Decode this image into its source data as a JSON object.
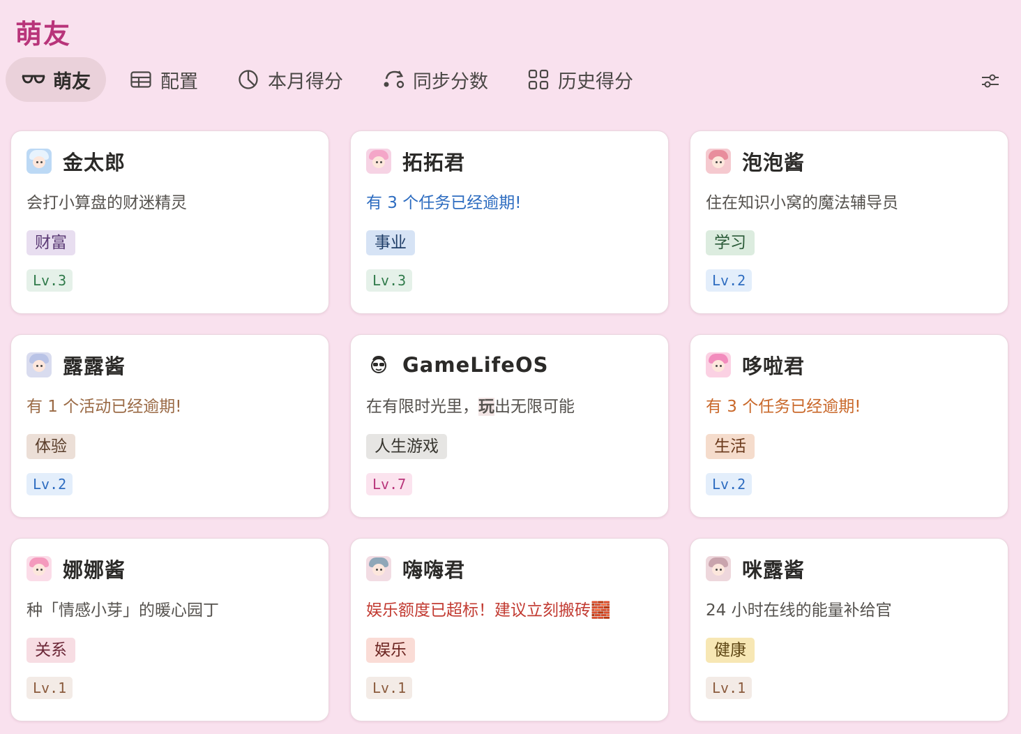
{
  "page": {
    "title": "萌友"
  },
  "tabs": [
    {
      "label": "萌友",
      "icon": "glasses-icon",
      "active": true
    },
    {
      "label": "配置",
      "icon": "table-icon",
      "active": false
    },
    {
      "label": "本月得分",
      "icon": "pie-chart-icon",
      "active": false
    },
    {
      "label": "同步分数",
      "icon": "sync-icon",
      "active": false
    },
    {
      "label": "历史得分",
      "icon": "gallery-icon",
      "active": false
    }
  ],
  "toolbar": {
    "filter_icon": "sliders-icon"
  },
  "cards": [
    {
      "name": "金太郎",
      "desc": "会打小算盘的财迷精灵",
      "desc_color": "#55524e",
      "tag": "财富",
      "tag_bg": "#e8def0",
      "tag_color": "#5b3a75",
      "level": "Lv.3",
      "lv_bg": "#e5f1e9",
      "lv_color": "#2f7a4a",
      "avatar_bg": "#bcd9f5",
      "avatar_hair": "#e8f3fd"
    },
    {
      "name": "拓拓君",
      "desc": "有 3 个任务已经逾期!",
      "desc_color": "#2d6cc0",
      "tag": "事业",
      "tag_bg": "#d6e3f5",
      "tag_color": "#1f3e68",
      "level": "Lv.3",
      "lv_bg": "#e5f1e9",
      "lv_color": "#2f7a4a",
      "avatar_bg": "#f6d3e4",
      "avatar_hair": "#f4a6c8"
    },
    {
      "name": "泡泡酱",
      "desc": "住在知识小窝的魔法辅导员",
      "desc_color": "#55524e",
      "tag": "学习",
      "tag_bg": "#dcecdf",
      "tag_color": "#2a5a37",
      "level": "Lv.2",
      "lv_bg": "#e3eefb",
      "lv_color": "#2d6cc0",
      "avatar_bg": "#f5c9cf",
      "avatar_hair": "#e88d9c"
    },
    {
      "name": "露露酱",
      "desc": "有 1 个活动已经逾期!",
      "desc_color": "#9a6a45",
      "tag": "体验",
      "tag_bg": "#ecdfd7",
      "tag_color": "#5a3e2b",
      "level": "Lv.2",
      "lv_bg": "#e3eefb",
      "lv_color": "#2d6cc0",
      "avatar_bg": "#d9dcef",
      "avatar_hair": "#b9c3e6"
    },
    {
      "name": "GameLifeOS",
      "desc": "在有限时光里，玩出无限可能",
      "desc_pre": "在有限时光里，",
      "desc_hl": "玩",
      "desc_post": "出无限可能",
      "desc_color": "#55524e",
      "tag": "人生游戏",
      "tag_bg": "#e6e5e3",
      "tag_color": "#37352f",
      "level": "Lv.7",
      "lv_bg": "#fbe3ee",
      "lv_color": "#b8347a",
      "avatar_bg": "#ffffff",
      "avatar_hair": "#2b2a28"
    },
    {
      "name": "哆啦君",
      "desc": "有 3 个任务已经逾期!",
      "desc_color": "#c9682a",
      "tag": "生活",
      "tag_bg": "#f5dccc",
      "tag_color": "#6b3a1c",
      "level": "Lv.2",
      "lv_bg": "#e3eefb",
      "lv_color": "#2d6cc0",
      "avatar_bg": "#fbd1e3",
      "avatar_hair": "#f28cbd"
    },
    {
      "name": "娜娜酱",
      "desc": "种「情感小芽」的暖心园丁",
      "desc_color": "#55524e",
      "tag": "关系",
      "tag_bg": "#f7dde3",
      "tag_color": "#6b2737",
      "level": "Lv.1",
      "lv_bg": "#f3ebe6",
      "lv_color": "#8a5a3c",
      "avatar_bg": "#fbdce8",
      "avatar_hair": "#f49abd"
    },
    {
      "name": "嗨嗨君",
      "desc": "娱乐额度已超标！建议立刻搬砖🧱",
      "desc_color": "#c23b32",
      "tag": "娱乐",
      "tag_bg": "#fadcd6",
      "tag_color": "#6b2420",
      "level": "Lv.1",
      "lv_bg": "#f3ebe6",
      "lv_color": "#8a5a3c",
      "avatar_bg": "#f2dce3",
      "avatar_hair": "#8fa7b8"
    },
    {
      "name": "咪露酱",
      "desc": "24 小时在线的能量补给官",
      "desc_color": "#55524e",
      "tag": "健康",
      "tag_bg": "#f7e7b4",
      "tag_color": "#5e4614",
      "level": "Lv.1",
      "lv_bg": "#f3ebe6",
      "lv_color": "#8a5a3c",
      "avatar_bg": "#eed7dc",
      "avatar_hair": "#c9a4ad"
    }
  ]
}
